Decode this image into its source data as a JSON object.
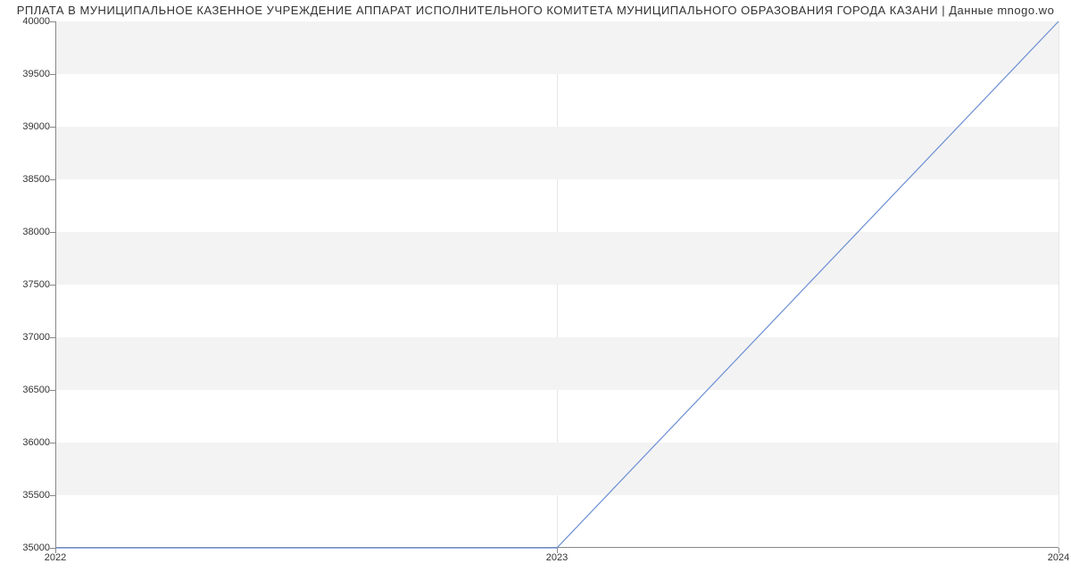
{
  "chart_data": {
    "type": "line",
    "title": "РПЛАТА В МУНИЦИПАЛЬНОЕ КАЗЕННОЕ УЧРЕЖДЕНИЕ АППАРАТ ИСПОЛНИТЕЛЬНОГО КОМИТЕТА МУНИЦИПАЛЬНОГО ОБРАЗОВАНИЯ ГОРОДА КАЗАНИ | Данные mnogo.wo",
    "x": [
      2022,
      2023,
      2024
    ],
    "values": [
      35000,
      35000,
      40000
    ],
    "x_ticks": [
      2022,
      2023,
      2024
    ],
    "y_ticks": [
      35000,
      35500,
      36000,
      36500,
      37000,
      37500,
      38000,
      38500,
      39000,
      39500,
      40000
    ],
    "xlim": [
      2022,
      2024
    ],
    "ylim": [
      35000,
      40000
    ],
    "line_color": "#6b8fd4"
  }
}
